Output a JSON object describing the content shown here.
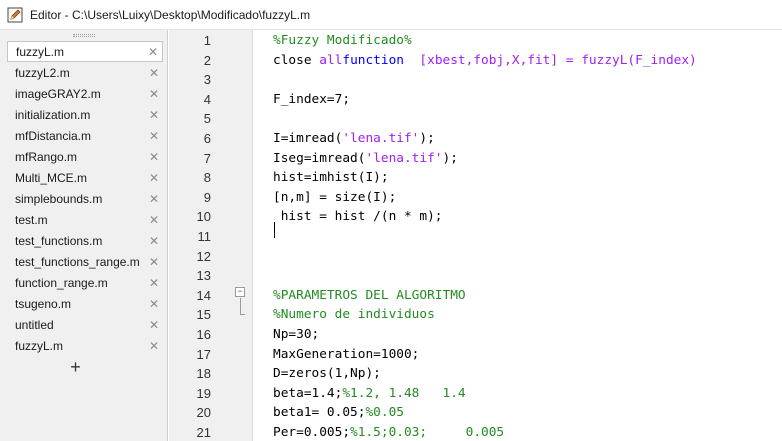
{
  "window": {
    "title": "Editor - C:\\Users\\Luixy\\Desktop\\Modificado\\fuzzyL.m"
  },
  "tabs": [
    {
      "label": "fuzzyL.m",
      "active": true
    },
    {
      "label": "fuzzyL2.m"
    },
    {
      "label": "imageGRAY2.m"
    },
    {
      "label": "initialization.m"
    },
    {
      "label": "mfDistancia.m"
    },
    {
      "label": "mfRango.m"
    },
    {
      "label": "Multi_MCE.m"
    },
    {
      "label": "simplebounds.m"
    },
    {
      "label": "test.m"
    },
    {
      "label": "test_functions.m"
    },
    {
      "label": "test_functions_range.m"
    },
    {
      "label": "function_range.m"
    },
    {
      "label": "tsugeno.m"
    },
    {
      "label": "untitled"
    },
    {
      "label": "fuzzyL.m"
    }
  ],
  "tab_close_glyph": "✕",
  "add_tab_glyph": "+",
  "colors": {
    "comment": "#228b22",
    "keyword": "#0000ff",
    "string": "#a020f0"
  },
  "code_lines": [
    {
      "n": "1",
      "parts": [
        {
          "t": "%Fuzzy Modificado%",
          "c": "cm"
        }
      ]
    },
    {
      "n": "2",
      "parts": [
        {
          "t": "close ",
          "c": ""
        },
        {
          "t": "all",
          "c": "st"
        },
        {
          "t": "function",
          "c": "kw"
        },
        {
          "t": "  [xbest,fobj,X,fit] = fuzzyL(F_index)",
          "c": "st"
        }
      ]
    },
    {
      "n": "3",
      "parts": []
    },
    {
      "n": "4",
      "parts": [
        {
          "t": "F_index=7;",
          "c": ""
        }
      ]
    },
    {
      "n": "5",
      "parts": []
    },
    {
      "n": "6",
      "parts": [
        {
          "t": "I=imread(",
          "c": ""
        },
        {
          "t": "'lena.tif'",
          "c": "st"
        },
        {
          "t": ");",
          "c": ""
        }
      ]
    },
    {
      "n": "7",
      "parts": [
        {
          "t": "Iseg=imread(",
          "c": ""
        },
        {
          "t": "'lena.tif'",
          "c": "st"
        },
        {
          "t": ");",
          "c": ""
        }
      ]
    },
    {
      "n": "8",
      "parts": [
        {
          "t": "hist=imhist(I);",
          "c": ""
        }
      ]
    },
    {
      "n": "9",
      "parts": [
        {
          "t": "[n,m] = size(I);",
          "c": ""
        }
      ]
    },
    {
      "n": "10",
      "parts": [
        {
          "t": " hist = hist /(n * m);",
          "c": ""
        }
      ]
    },
    {
      "n": "11",
      "parts": []
    },
    {
      "n": "12",
      "parts": []
    },
    {
      "n": "13",
      "parts": []
    },
    {
      "n": "14",
      "parts": [
        {
          "t": "%PARAMETROS DEL ALGORITMO",
          "c": "cm"
        }
      ]
    },
    {
      "n": "15",
      "parts": [
        {
          "t": "%Numero de individuos",
          "c": "cm"
        }
      ]
    },
    {
      "n": "16",
      "parts": [
        {
          "t": "Np=30;",
          "c": ""
        }
      ]
    },
    {
      "n": "17",
      "parts": [
        {
          "t": "MaxGeneration=1000;",
          "c": ""
        }
      ]
    },
    {
      "n": "18",
      "parts": [
        {
          "t": "D=zeros(1,Np);",
          "c": ""
        }
      ]
    },
    {
      "n": "19",
      "parts": [
        {
          "t": "beta=1.4;",
          "c": ""
        },
        {
          "t": "%1.2, 1.48   1.4",
          "c": "cm"
        }
      ]
    },
    {
      "n": "20",
      "parts": [
        {
          "t": "beta1= 0.05;",
          "c": ""
        },
        {
          "t": "%0.05",
          "c": "cm"
        }
      ]
    },
    {
      "n": "21",
      "parts": [
        {
          "t": "Per=0.005;",
          "c": ""
        },
        {
          "t": "%1.5;0.03;     0.005",
          "c": "cm"
        }
      ]
    }
  ],
  "fold_glyph": "−"
}
